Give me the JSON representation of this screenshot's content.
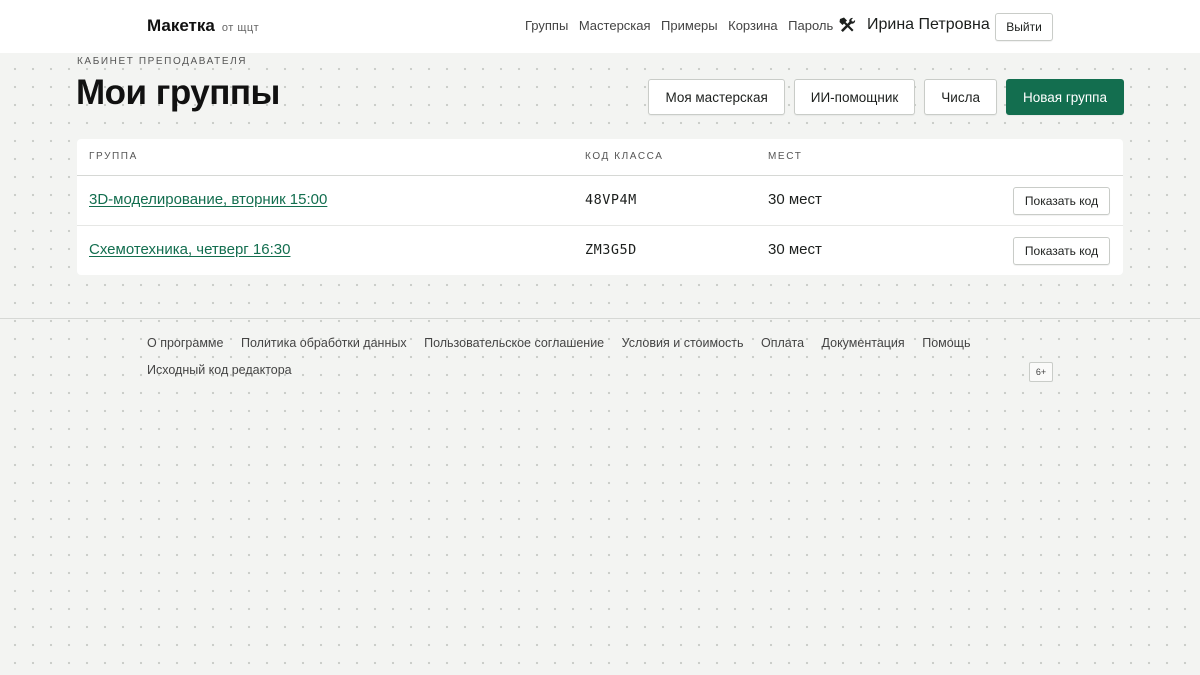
{
  "header": {
    "brand": "Макетка",
    "brand_sub": "от щцт",
    "nav": [
      "Группы",
      "Мастерская",
      "Примеры",
      "Корзина",
      "Пароль"
    ],
    "tools_icon": "hammer-wrench-icon",
    "user_name": "Ирина Петровна",
    "logout_label": "Выйти"
  },
  "page": {
    "overline": "Кабинет преподавателя",
    "title": "Мои группы",
    "actions": {
      "workshop": "Моя мастерская",
      "ai": "ИИ-помощник",
      "numbers": "Числа",
      "new_group": "Новая группа"
    }
  },
  "table": {
    "headers": {
      "group": "Группа",
      "code": "Код класса",
      "seats": "Мест"
    },
    "rows": [
      {
        "group": "3D-моделирование, вторник 15:00",
        "code": "48VP4M",
        "seats": "30 мест",
        "button": "Показать код"
      },
      {
        "group": "Схемотехника, четверг 16:30",
        "code": "ZM3G5D",
        "seats": "30 мест",
        "button": "Показать код"
      }
    ]
  },
  "footer": {
    "links": [
      "О программе",
      "Политика обработки данных",
      "Пользовательское соглашение",
      "Условия и стоимость",
      "Оплата",
      "Документация",
      "Помощь"
    ],
    "source_link": "Исходный код редактора",
    "age_rating": "6+"
  },
  "colors": {
    "accent": "#136e4f",
    "background": "#f3f4f2"
  }
}
